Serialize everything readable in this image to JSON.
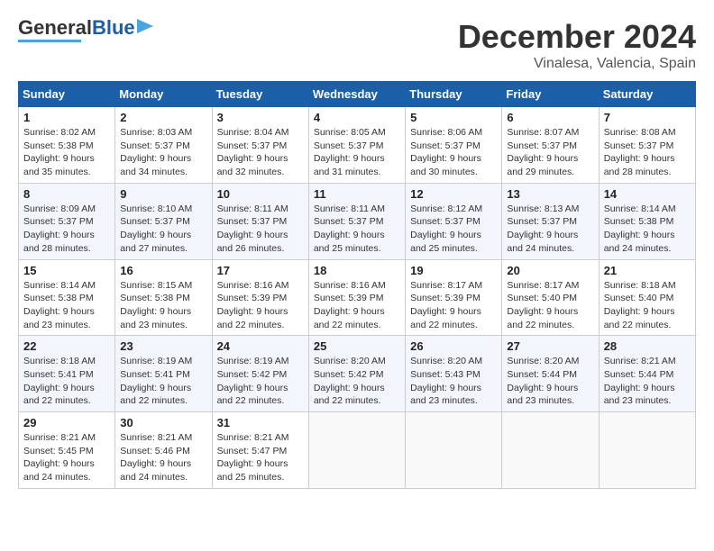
{
  "header": {
    "logo_text_general": "General",
    "logo_text_blue": "Blue",
    "month": "December 2024",
    "location": "Vinalesa, Valencia, Spain"
  },
  "calendar": {
    "days_of_week": [
      "Sunday",
      "Monday",
      "Tuesday",
      "Wednesday",
      "Thursday",
      "Friday",
      "Saturday"
    ],
    "weeks": [
      [
        null,
        {
          "day": 2,
          "sunrise": "8:03 AM",
          "sunset": "5:37 PM",
          "daylight": "9 hours and 34 minutes."
        },
        {
          "day": 3,
          "sunrise": "8:04 AM",
          "sunset": "5:37 PM",
          "daylight": "9 hours and 32 minutes."
        },
        {
          "day": 4,
          "sunrise": "8:05 AM",
          "sunset": "5:37 PM",
          "daylight": "9 hours and 31 minutes."
        },
        {
          "day": 5,
          "sunrise": "8:06 AM",
          "sunset": "5:37 PM",
          "daylight": "9 hours and 30 minutes."
        },
        {
          "day": 6,
          "sunrise": "8:07 AM",
          "sunset": "5:37 PM",
          "daylight": "9 hours and 29 minutes."
        },
        {
          "day": 7,
          "sunrise": "8:08 AM",
          "sunset": "5:37 PM",
          "daylight": "9 hours and 28 minutes."
        }
      ],
      [
        {
          "day": 1,
          "sunrise": "8:02 AM",
          "sunset": "5:38 PM",
          "daylight": "9 hours and 35 minutes."
        },
        {
          "day": 9,
          "sunrise": "8:10 AM",
          "sunset": "5:37 PM",
          "daylight": "9 hours and 27 minutes."
        },
        {
          "day": 10,
          "sunrise": "8:11 AM",
          "sunset": "5:37 PM",
          "daylight": "9 hours and 26 minutes."
        },
        {
          "day": 11,
          "sunrise": "8:11 AM",
          "sunset": "5:37 PM",
          "daylight": "9 hours and 25 minutes."
        },
        {
          "day": 12,
          "sunrise": "8:12 AM",
          "sunset": "5:37 PM",
          "daylight": "9 hours and 25 minutes."
        },
        {
          "day": 13,
          "sunrise": "8:13 AM",
          "sunset": "5:37 PM",
          "daylight": "9 hours and 24 minutes."
        },
        {
          "day": 14,
          "sunrise": "8:14 AM",
          "sunset": "5:38 PM",
          "daylight": "9 hours and 24 minutes."
        }
      ],
      [
        {
          "day": 8,
          "sunrise": "8:09 AM",
          "sunset": "5:37 PM",
          "daylight": "9 hours and 28 minutes."
        },
        {
          "day": 16,
          "sunrise": "8:15 AM",
          "sunset": "5:38 PM",
          "daylight": "9 hours and 23 minutes."
        },
        {
          "day": 17,
          "sunrise": "8:16 AM",
          "sunset": "5:39 PM",
          "daylight": "9 hours and 22 minutes."
        },
        {
          "day": 18,
          "sunrise": "8:16 AM",
          "sunset": "5:39 PM",
          "daylight": "9 hours and 22 minutes."
        },
        {
          "day": 19,
          "sunrise": "8:17 AM",
          "sunset": "5:39 PM",
          "daylight": "9 hours and 22 minutes."
        },
        {
          "day": 20,
          "sunrise": "8:17 AM",
          "sunset": "5:40 PM",
          "daylight": "9 hours and 22 minutes."
        },
        {
          "day": 21,
          "sunrise": "8:18 AM",
          "sunset": "5:40 PM",
          "daylight": "9 hours and 22 minutes."
        }
      ],
      [
        {
          "day": 15,
          "sunrise": "8:14 AM",
          "sunset": "5:38 PM",
          "daylight": "9 hours and 23 minutes."
        },
        {
          "day": 23,
          "sunrise": "8:19 AM",
          "sunset": "5:41 PM",
          "daylight": "9 hours and 22 minutes."
        },
        {
          "day": 24,
          "sunrise": "8:19 AM",
          "sunset": "5:42 PM",
          "daylight": "9 hours and 22 minutes."
        },
        {
          "day": 25,
          "sunrise": "8:20 AM",
          "sunset": "5:42 PM",
          "daylight": "9 hours and 22 minutes."
        },
        {
          "day": 26,
          "sunrise": "8:20 AM",
          "sunset": "5:43 PM",
          "daylight": "9 hours and 23 minutes."
        },
        {
          "day": 27,
          "sunrise": "8:20 AM",
          "sunset": "5:44 PM",
          "daylight": "9 hours and 23 minutes."
        },
        {
          "day": 28,
          "sunrise": "8:21 AM",
          "sunset": "5:44 PM",
          "daylight": "9 hours and 23 minutes."
        }
      ],
      [
        {
          "day": 22,
          "sunrise": "8:18 AM",
          "sunset": "5:41 PM",
          "daylight": "9 hours and 22 minutes."
        },
        {
          "day": 30,
          "sunrise": "8:21 AM",
          "sunset": "5:46 PM",
          "daylight": "9 hours and 24 minutes."
        },
        {
          "day": 31,
          "sunrise": "8:21 AM",
          "sunset": "5:47 PM",
          "daylight": "9 hours and 25 minutes."
        },
        null,
        null,
        null,
        null
      ],
      [
        {
          "day": 29,
          "sunrise": "8:21 AM",
          "sunset": "5:45 PM",
          "daylight": "9 hours and 24 minutes."
        },
        null,
        null,
        null,
        null,
        null,
        null
      ]
    ]
  }
}
